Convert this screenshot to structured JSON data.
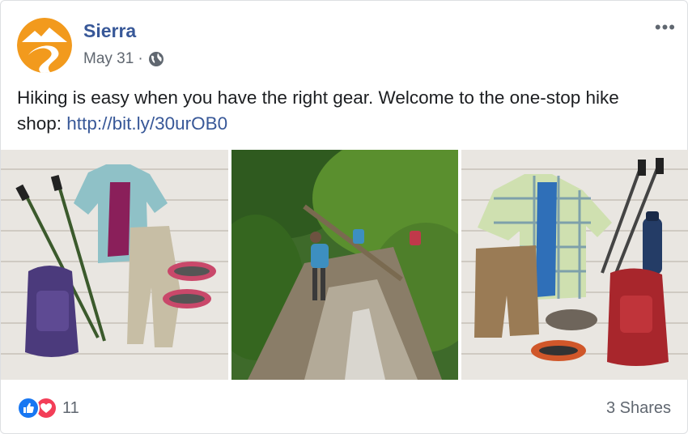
{
  "post": {
    "page_name": "Sierra",
    "date": "May 31",
    "separator": "·",
    "privacy_icon": "globe-icon",
    "more_icon": "more-options-icon",
    "more_glyph": "•••",
    "text": "Hiking is easy when you have the right gear. Welcome to the one-stop hike shop: ",
    "link": "http://bit.ly/30urOB0"
  },
  "photos": [
    {
      "name": "womens-hiking-gear-flatlay"
    },
    {
      "name": "hikers-on-forest-creek-trail"
    },
    {
      "name": "mens-hiking-gear-flatlay"
    }
  ],
  "footer": {
    "reaction_icons": [
      "like-icon",
      "love-icon"
    ],
    "reaction_count": "11",
    "shares": "3 Shares"
  },
  "colors": {
    "brand_orange": "#f29a1d",
    "link_blue": "#385898",
    "like_blue": "#1877f2",
    "love_red": "#f33e58",
    "meta_gray": "#606770"
  }
}
